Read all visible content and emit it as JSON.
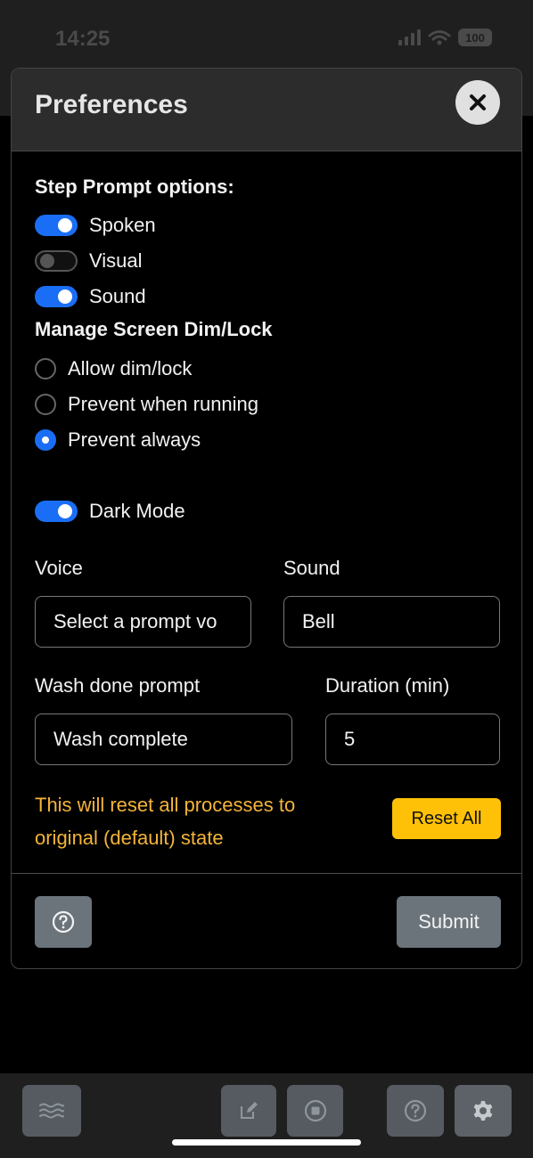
{
  "status": {
    "time": "14:25",
    "battery": "100"
  },
  "modal": {
    "title": "Preferences",
    "step_prompt": {
      "heading": "Step Prompt options:",
      "options": [
        {
          "label": "Spoken",
          "on": true
        },
        {
          "label": "Visual",
          "on": false
        },
        {
          "label": "Sound",
          "on": true
        }
      ]
    },
    "screen_dim": {
      "heading": "Manage Screen Dim/Lock",
      "options": [
        {
          "label": "Allow dim/lock",
          "selected": false
        },
        {
          "label": "Prevent when running",
          "selected": false
        },
        {
          "label": "Prevent always",
          "selected": true
        }
      ]
    },
    "dark_mode": {
      "label": "Dark Mode",
      "on": true
    },
    "voice": {
      "label": "Voice",
      "value": "Select a prompt vo"
    },
    "sound": {
      "label": "Sound",
      "value": "Bell"
    },
    "wash_done": {
      "label": "Wash done prompt",
      "value": "Wash complete"
    },
    "duration": {
      "label": "Duration (min)",
      "value": "5"
    },
    "warning": "This will reset all processes to original (default) state",
    "reset_label": "Reset All",
    "submit_label": "Submit"
  },
  "colors": {
    "accent": "#1a6ef5",
    "warning": "#f4b43a",
    "reset": "#ffc107"
  }
}
